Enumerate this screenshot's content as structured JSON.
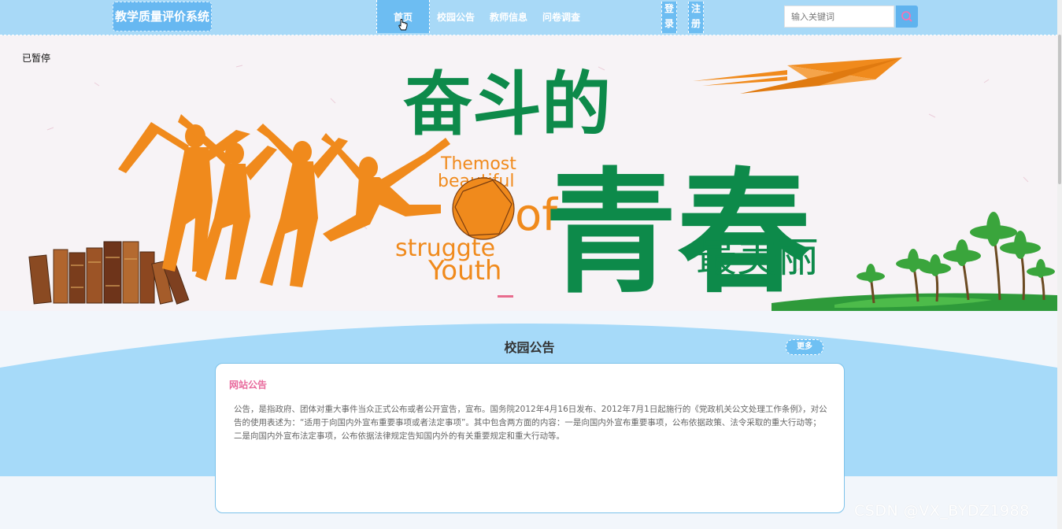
{
  "header": {
    "site_title": "教学质量评价系统",
    "nav": [
      "首页",
      "校园公告",
      "教师信息",
      "问卷调查"
    ],
    "login_label": [
      "登",
      "录"
    ],
    "register_label": [
      "注",
      "册"
    ],
    "search_placeholder": "输入关键词"
  },
  "banner": {
    "overlay_status": "已暂停",
    "headline_1": "奋斗的",
    "headline_2": "青春",
    "headline_3": "最美丽",
    "english_lines": [
      "Themost",
      "beautiful",
      "of",
      "struggte",
      "Youth"
    ]
  },
  "notice_section": {
    "title": "校园公告",
    "more_label": "更多",
    "card_heading": "网站公告",
    "card_body": "公告，是指政府、团体对重大事件当众正式公布或者公开宣告，宣布。国务院2012年4月16日发布、2012年7月1日起施行的《党政机关公文处理工作条例》，对公告的使用表述为：“适用于向国内外宣布重要事项或者法定事项”。其中包含两方面的内容：一是向国内外宣布重要事项，公布依据政策、法令采取的重大行动等；二是向国内外宣布法定事项，公布依据法律规定告知国内外的有关重要规定和重大行动等。"
  },
  "watermark": "CSDN @VX_BYDZ1988",
  "colors": {
    "header_bg": "#a8d9f7",
    "accent_blue": "#6dbdf2",
    "headline_green": "#0d8a4a",
    "figure_orange": "#f08a1c",
    "notice_pink": "#e86b9d"
  },
  "icons": [
    "search-icon",
    "hand-cursor-icon",
    "shutter-icon"
  ]
}
